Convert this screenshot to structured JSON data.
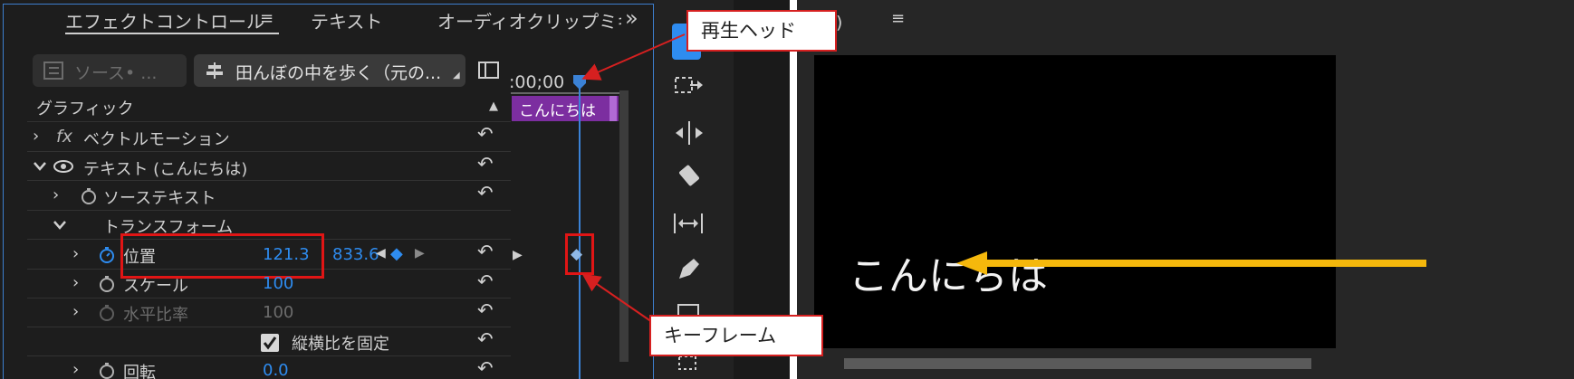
{
  "tabs": [
    {
      "label": "エフェクトコントロール"
    },
    {
      "label": "テキスト"
    },
    {
      "label": "オーディオクリップミキ"
    }
  ],
  "tab_menu_glyph": "≡",
  "tab_overflow_glyph": "»",
  "source_chip": {
    "label": "ソース• ..."
  },
  "clip_chip": {
    "label": "田んぼの中を歩く（元の..."
  },
  "mini_timeline": {
    "timecode": ":00;00",
    "clip_label": "こんにちは"
  },
  "rows": {
    "graphic": "グラフィック",
    "vector_motion": "ベクトルモーション",
    "fx_badge": "fx",
    "text_layer": "テキスト (こんにちは)",
    "source_text": "ソーステキスト",
    "transform": "トランスフォーム",
    "position": {
      "label": "位置",
      "x": "121.3",
      "y": "833.6"
    },
    "scale": {
      "label": "スケール",
      "value": "100"
    },
    "horizontal_scale": {
      "label": "水平比率",
      "value": "100"
    },
    "uniform_scale": {
      "label": "縦横比を固定",
      "checked": true
    },
    "rotation": {
      "label": "回転",
      "value": "0.0"
    }
  },
  "program_monitor": {
    "title_fragment": "像)",
    "menu_glyph": "≡",
    "overlay_text": "こんにちは"
  },
  "callouts": {
    "playhead": "再生ヘッド",
    "keyframe": "キーフレーム"
  },
  "colors": {
    "accent_blue": "#2e8cf0",
    "clip_purple": "#7c2ea0",
    "callout_red": "#d62020",
    "arrow_yellow": "#f5b80c"
  },
  "icons": [
    "menu-icon",
    "chevron-right-icon",
    "chevron-down-icon",
    "eye-icon",
    "stopwatch-icon",
    "reset-icon",
    "keyframe-diamond-icon",
    "selection-tool-icon",
    "track-select-icon",
    "ripple-edit-icon",
    "razor-icon",
    "slip-icon",
    "pen-icon",
    "checkbox-icon"
  ]
}
